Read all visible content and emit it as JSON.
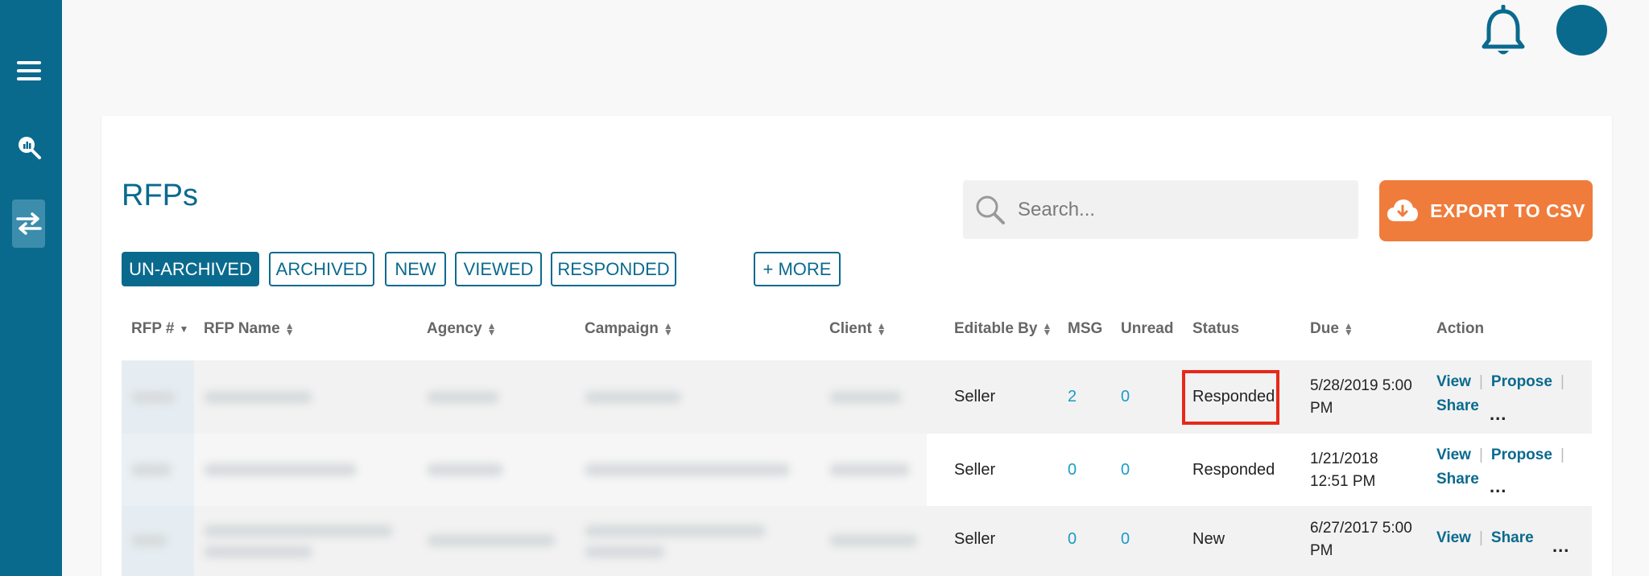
{
  "header": {
    "page_title": "RFPs"
  },
  "search": {
    "placeholder": "Search..."
  },
  "export": {
    "label": "EXPORT TO CSV"
  },
  "filters": [
    "UN-ARCHIVED",
    "ARCHIVED",
    "NEW",
    "VIEWED",
    "RESPONDED"
  ],
  "more_label": "+ MORE",
  "columns": {
    "rfp_num": "RFP #",
    "rfp_name": "RFP Name",
    "agency": "Agency",
    "campaign": "Campaign",
    "client": "Client",
    "editable_by": "Editable By",
    "msg": "MSG",
    "unread": "Unread",
    "status": "Status",
    "due": "Due",
    "action": "Action"
  },
  "rows": [
    {
      "editable_by": "Seller",
      "msg": "2",
      "unread": "0",
      "status": "Responded",
      "due_line1": "5/28/2019 5:00",
      "due_line2": "PM",
      "action_view": "View",
      "action_propose": "Propose",
      "action_share": "Share",
      "more": "..."
    },
    {
      "editable_by": "Seller",
      "msg": "0",
      "unread": "0",
      "status": "Responded",
      "due_line1": "1/21/2018",
      "due_line2": "12:51 PM",
      "action_view": "View",
      "action_propose": "Propose",
      "action_share": "Share",
      "more": "..."
    },
    {
      "editable_by": "Seller",
      "msg": "0",
      "unread": "0",
      "status": "New",
      "due_line1": "6/27/2017 5:00",
      "due_line2": "PM",
      "action_view": "View",
      "action_share": "Share",
      "more": "..."
    }
  ]
}
